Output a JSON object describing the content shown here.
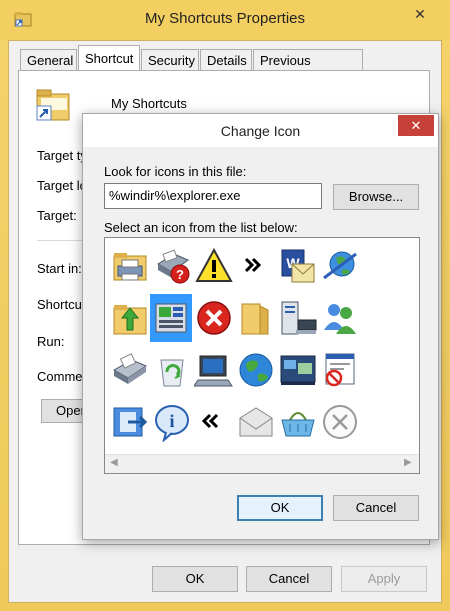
{
  "properties_window": {
    "title": "My Shortcuts Properties",
    "close_glyph": "✕",
    "tabs": [
      {
        "label": "General"
      },
      {
        "label": "Shortcut"
      },
      {
        "label": "Security"
      },
      {
        "label": "Details"
      },
      {
        "label": "Previous Versions"
      }
    ],
    "active_tab": "Shortcut",
    "shortcut_name": "My Shortcuts",
    "field_labels": {
      "target_type": "Target ty",
      "target_location": "Target lo",
      "target": "Target:",
      "start_in": "Start in:",
      "shortcut_key": "Shortcut",
      "run": "Run:",
      "comment": "Commen"
    },
    "open_button": "Oper",
    "buttons": {
      "ok": "OK",
      "cancel": "Cancel",
      "apply": "Apply"
    }
  },
  "change_icon_dialog": {
    "title": "Change Icon",
    "close_glyph": "✕",
    "look_label": "Look for icons in this file:",
    "path_value": "%windir%\\explorer.exe",
    "browse_button": "Browse...",
    "select_label": "Select an icon from the list below:",
    "icons": [
      "folder-with-printer-icon",
      "printer-error-icon",
      "warning-icon",
      "double-chevron-right-icon",
      "word-document-icon",
      "network-globe-icon",
      "folder-up-arrow-icon",
      "control-panel-icon",
      "error-icon",
      "open-folder-icon",
      "server-computer-icon",
      "users-icon",
      "printer-icon",
      "recycle-bin-icon",
      "computer-icon",
      "globe-icon",
      "windows-desktop-icon",
      "blocked-document-icon",
      "exit-icon",
      "info-icon",
      "double-chevron-left-icon",
      "envelope-icon",
      "shopping-basket-icon",
      "circle-x-icon"
    ],
    "selected_icon": "control-panel-icon",
    "buttons": {
      "ok": "OK",
      "cancel": "Cancel"
    },
    "colors": {
      "close_red": "#c7413b",
      "selection_blue": "#3399ff",
      "default_button_border": "#3c7fb1"
    }
  }
}
